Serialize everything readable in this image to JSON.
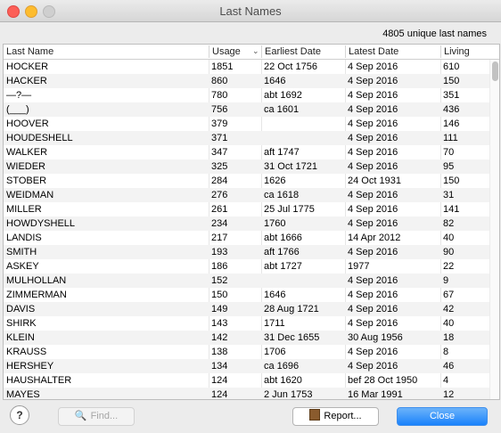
{
  "window": {
    "title": "Last Names"
  },
  "summary": "4805 unique last names",
  "table": {
    "headers": [
      "Last Name",
      "Usage",
      "Earliest Date",
      "Latest Date",
      "Living"
    ],
    "rows": [
      [
        "HOCKER",
        "1851",
        "22 Oct 1756",
        "4 Sep 2016",
        "610"
      ],
      [
        "HACKER",
        "860",
        "1646",
        "4 Sep 2016",
        "150"
      ],
      [
        "—?—",
        "780",
        "abt 1692",
        "4 Sep 2016",
        "351"
      ],
      [
        "(___)",
        "756",
        "ca 1601",
        "4 Sep 2016",
        "436"
      ],
      [
        "HOOVER",
        "379",
        "",
        "4 Sep 2016",
        "146"
      ],
      [
        "HOUDESHELL",
        "371",
        "",
        "4 Sep 2016",
        "111"
      ],
      [
        "WALKER",
        "347",
        "aft 1747",
        "4 Sep 2016",
        "70"
      ],
      [
        "WIEDER",
        "325",
        "31 Oct 1721",
        "4 Sep 2016",
        "95"
      ],
      [
        "STOBER",
        "284",
        "1626",
        "24 Oct 1931",
        "150"
      ],
      [
        "WEIDMAN",
        "276",
        "ca 1618",
        "4 Sep 2016",
        "31"
      ],
      [
        "MILLER",
        "261",
        "25 Jul 1775",
        "4 Sep 2016",
        "141"
      ],
      [
        "HOWDYSHELL",
        "234",
        "1760",
        "4 Sep 2016",
        "82"
      ],
      [
        "LANDIS",
        "217",
        "abt 1666",
        "14 Apr 2012",
        "40"
      ],
      [
        "SMITH",
        "193",
        "aft 1766",
        "4 Sep 2016",
        "90"
      ],
      [
        "ASKEY",
        "186",
        "abt 1727",
        "1977",
        "22"
      ],
      [
        "MULHOLLAN",
        "152",
        "",
        "4 Sep 2016",
        "9"
      ],
      [
        "ZIMMERMAN",
        "150",
        "1646",
        "4 Sep 2016",
        "67"
      ],
      [
        "DAVIS",
        "149",
        "28 Aug 1721",
        "4 Sep 2016",
        "42"
      ],
      [
        "SHIRK",
        "143",
        "1711",
        "4 Sep 2016",
        "40"
      ],
      [
        "KLEIN",
        "142",
        "31 Dec 1655",
        "30 Aug 1956",
        "18"
      ],
      [
        "KRAUSS",
        "138",
        "1706",
        "4 Sep 2016",
        "8"
      ],
      [
        "HERSHEY",
        "134",
        "ca 1696",
        "4 Sep 2016",
        "46"
      ],
      [
        "HAUSHALTER",
        "124",
        "abt 1620",
        "bef 28 Oct 1950",
        "4"
      ],
      [
        "MAYES",
        "124",
        "2 Jun 1753",
        "16 Mar 1991",
        "12"
      ]
    ]
  },
  "buttons": {
    "help": "?",
    "find": "Find...",
    "report": "Report...",
    "close": "Close"
  },
  "colors": {
    "accent": "#1a82fb"
  }
}
